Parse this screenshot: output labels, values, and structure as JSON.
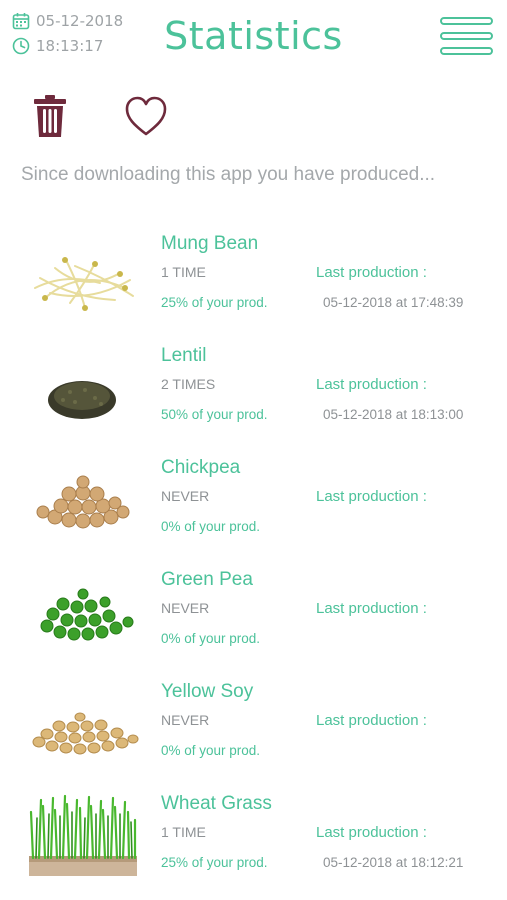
{
  "status": {
    "date": "05-12-2018",
    "time": "18:13:17"
  },
  "header": {
    "title": "Statistics"
  },
  "actions": {
    "delete_icon": "trash-icon",
    "favorite_icon": "heart-icon"
  },
  "intro": "Since downloading this app you have produced...",
  "last_label": "Last production :",
  "colors": {
    "accent": "#4cc29a",
    "muted": "#9ea3a6",
    "icon": "#6e2a3c"
  },
  "items": [
    {
      "name": "Mung Bean",
      "count": "1 TIME",
      "share": "25% of your prod.",
      "last": "05-12-2018 at 17:48:39"
    },
    {
      "name": "Lentil",
      "count": "2 TIMES",
      "share": "50% of your prod.",
      "last": "05-12-2018 at 18:13:00"
    },
    {
      "name": "Chickpea",
      "count": "NEVER",
      "share": "0% of your prod.",
      "last": ""
    },
    {
      "name": "Green Pea",
      "count": "NEVER",
      "share": "0% of your prod.",
      "last": ""
    },
    {
      "name": "Yellow Soy",
      "count": "NEVER",
      "share": "0% of your prod.",
      "last": ""
    },
    {
      "name": "Wheat Grass",
      "count": "1 TIME",
      "share": "25% of your prod.",
      "last": "05-12-2018 at 18:12:21"
    }
  ]
}
